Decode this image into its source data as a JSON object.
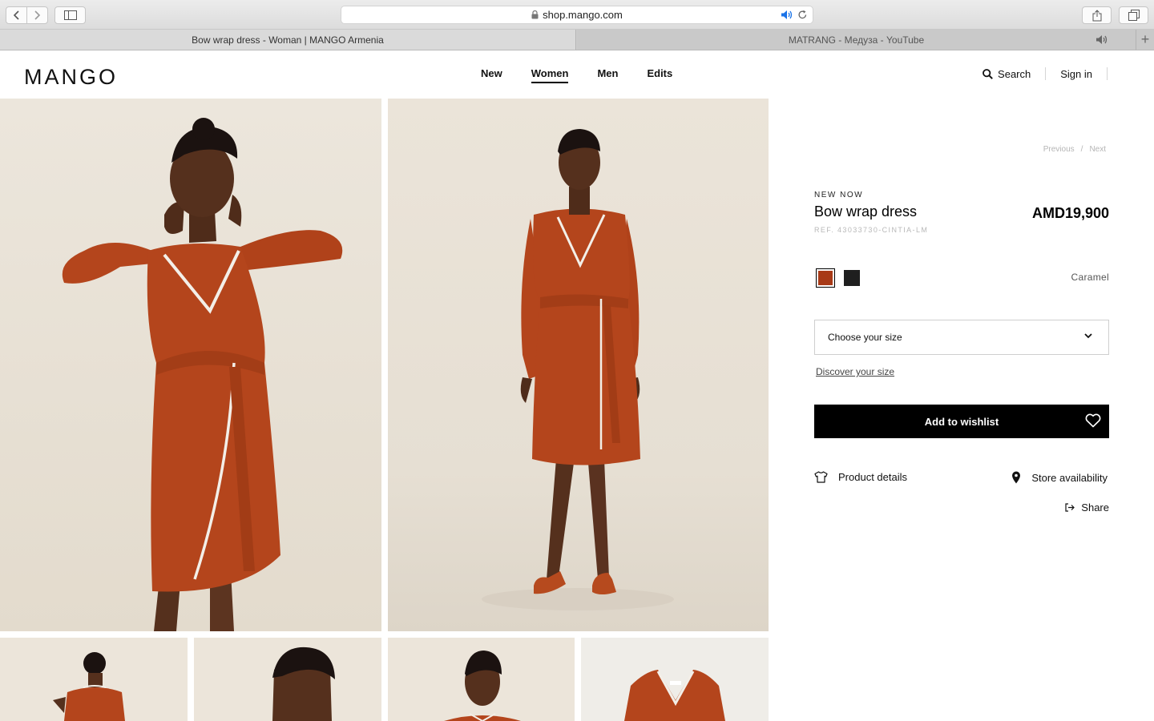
{
  "browser": {
    "url": "shop.mango.com",
    "tabs": [
      {
        "title": "Bow wrap dress - Woman | MANGO Armenia",
        "active": true
      },
      {
        "title": "MATRANG - Медуза - YouTube",
        "active": false,
        "audio": true
      }
    ],
    "new_tab": "+"
  },
  "header": {
    "logo": "MANGO",
    "nav": [
      "New",
      "Women",
      "Men",
      "Edits"
    ],
    "active_nav": "Women",
    "search_label": "Search",
    "signin_label": "Sign in"
  },
  "product": {
    "pager_previous": "Previous",
    "pager_sep": "/",
    "pager_next": "Next",
    "badge": "NEW NOW",
    "name": "Bow wrap dress",
    "ref": "REF. 43033730-CINTIA-LM",
    "price": "AMD19,900",
    "colors": [
      {
        "name": "Caramel",
        "hex": "#a83a17",
        "selected": true
      },
      {
        "name": "Black",
        "hex": "#1f1f1f",
        "selected": false
      }
    ],
    "selected_color": "Caramel",
    "size_placeholder": "Choose your size",
    "discover_size": "Discover your size",
    "wishlist_label": "Add to wishlist",
    "details_label": "Product details",
    "store_label": "Store availability",
    "share_label": "Share"
  },
  "theme": {
    "dress_color": "#b4451c",
    "skin_color": "#5a3420",
    "backdrop": "#e8e1d5"
  }
}
